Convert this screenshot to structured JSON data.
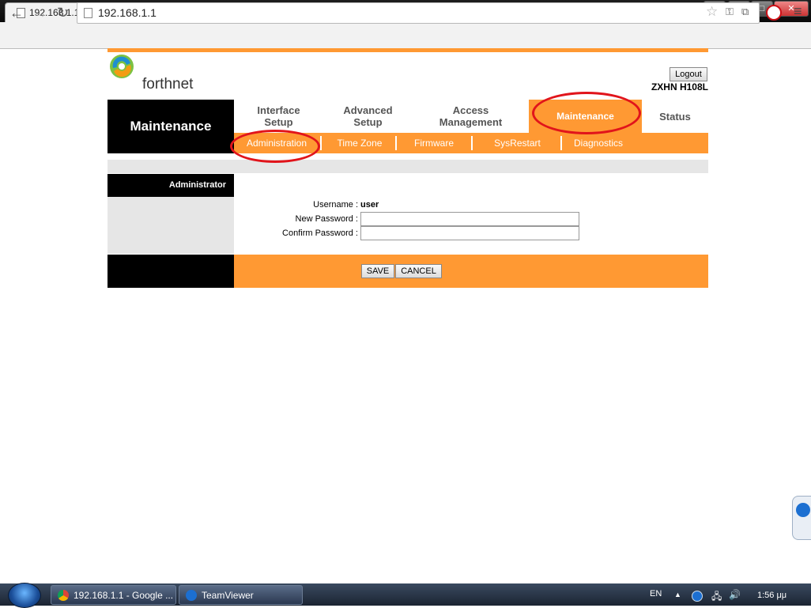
{
  "browser": {
    "tab_title": "192.168.1.1",
    "tab_close": "×",
    "url": "192.168.1.1",
    "win_min": "–",
    "win_max": "□",
    "win_close": "✕"
  },
  "router": {
    "brand": "forthnet",
    "logout_label": "Logout",
    "model": "ZXHN H108L",
    "section_title": "Maintenance",
    "main_tabs": [
      {
        "label_line1": "Interface",
        "label_line2": "Setup"
      },
      {
        "label_line1": "Advanced",
        "label_line2": "Setup"
      },
      {
        "label_line1": "Access",
        "label_line2": "Management"
      },
      {
        "label_line1": "Maintenance",
        "label_line2": ""
      },
      {
        "label_line1": "Status",
        "label_line2": ""
      }
    ],
    "sub_tabs": [
      "Administration",
      "Time Zone",
      "Firmware",
      "SysRestart",
      "Diagnostics"
    ],
    "panel_label": "Administrator",
    "form": {
      "username_label": "Username :",
      "username_value": "user",
      "new_password_label": "New Password :",
      "new_password_value": "",
      "confirm_password_label": "Confirm Password :",
      "confirm_password_value": ""
    },
    "save_label": "SAVE",
    "cancel_label": "CANCEL"
  },
  "taskbar": {
    "task_chrome": "192.168.1.1 - Google ...",
    "task_teamviewer": "TeamViewer",
    "lang": "EN",
    "clock": "1:56 μμ"
  },
  "colors": {
    "accent_orange": "#ff9933",
    "highlight_red": "#e1141b"
  },
  "icons": [
    "page-icon",
    "back-arrow-icon",
    "forward-arrow-icon",
    "reload-icon",
    "star-icon",
    "key-icon",
    "extension-icon",
    "opera-icon",
    "chrome-menu-icon",
    "forthnet-logo-icon",
    "teamviewer-icon",
    "windows-start-icon",
    "volume-icon",
    "network-icon"
  ]
}
